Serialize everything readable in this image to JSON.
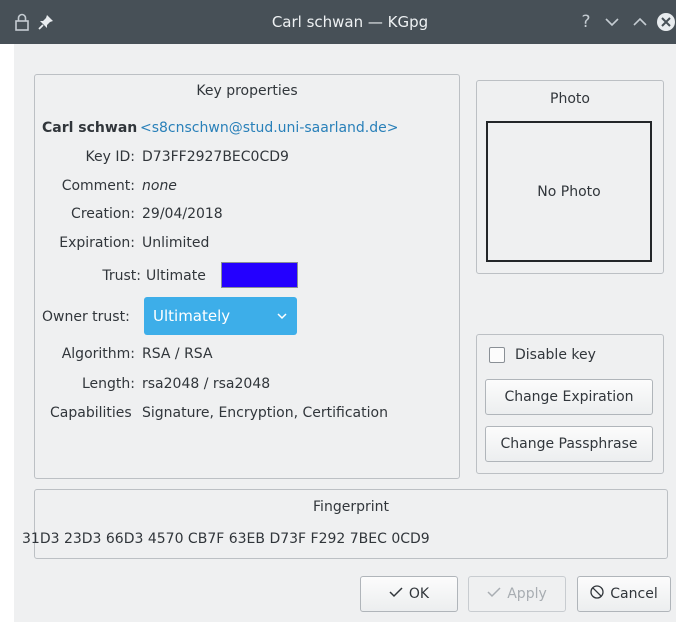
{
  "titlebar": {
    "title": "Carl schwan — KGpg",
    "icons": [
      "lock-icon",
      "pin-icon",
      "help-icon",
      "minimize-icon",
      "maximize-icon",
      "close-icon"
    ]
  },
  "key_properties": {
    "group_title": "Key properties",
    "name": "Carl schwan",
    "email": "<s8cnschwn@stud.uni-saarland.de>",
    "key_id_label": "Key ID:",
    "key_id": "D73FF2927BEC0CD9",
    "comment_label": "Comment:",
    "comment": "none",
    "creation_label": "Creation:",
    "creation": "29/04/2018",
    "expiration_label": "Expiration:",
    "expiration": "Unlimited",
    "trust_label": "Trust:",
    "trust": "Ultimate",
    "trust_color": "#2400ff",
    "owner_trust_label": "Owner trust:",
    "owner_trust": "Ultimately",
    "algorithm_label": "Algorithm:",
    "algorithm": "RSA / RSA",
    "length_label": "Length:",
    "length": "rsa2048 / rsa2048",
    "capabilities_label": "Capabilities",
    "capabilities": "Signature, Encryption, Certification"
  },
  "photo": {
    "group_title": "Photo",
    "placeholder": "No Photo"
  },
  "actions": {
    "disable_key_label": "Disable key",
    "disable_key_checked": false,
    "change_expiration_label": "Change Expiration",
    "change_passphrase_label": "Change Passphrase"
  },
  "fingerprint": {
    "group_title": "Fingerprint",
    "value": "31D3 23D3 66D3 4570 CB7F 63EB D73F F292 7BEC 0CD9"
  },
  "buttons": {
    "ok_label": "OK",
    "apply_label": "Apply",
    "cancel_label": "Cancel"
  },
  "colors": {
    "accent": "#3daee9",
    "link": "#2980b9",
    "titlebar": "#475057",
    "window_bg": "#eff0f1"
  }
}
